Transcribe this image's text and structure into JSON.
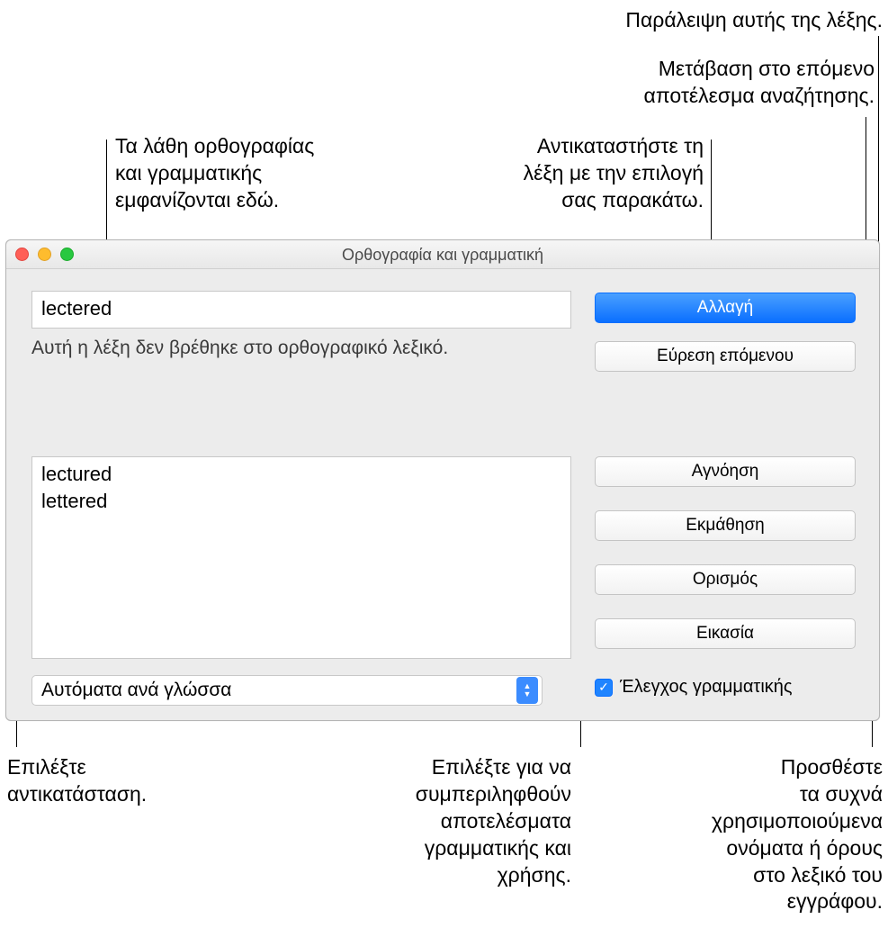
{
  "callouts": {
    "skip": "Παράλειψη αυτής της λέξης.",
    "next1": "Μετάβαση στο επόμενο",
    "next2": "αποτέλεσμα αναζήτησης.",
    "errors1": "Τα λάθη ορθογραφίας",
    "errors2": "και γραμματικής",
    "errors3": "εμφανίζονται εδώ.",
    "replace1": "Αντικαταστήστε τη",
    "replace2": "λέξη με την επιλογή",
    "replace3": "σας παρακάτω.",
    "pickrepl1": "Επιλέξτε",
    "pickrepl2": "αντικατάσταση.",
    "grammar1": "Επιλέξτε για να",
    "grammar2": "συμπεριληφθούν",
    "grammar3": "αποτελέσματα",
    "grammar4": "γραμματικής και",
    "grammar5": "χρήσης.",
    "learn1": "Προσθέστε",
    "learn2": "τα συχνά",
    "learn3": "χρησιμοποιούμενα",
    "learn4": "ονόματα ή όρους",
    "learn5": "στο λεξικό του",
    "learn6": "εγγράφου."
  },
  "window": {
    "title": "Ορθογραφία και γραμματική",
    "misspelled": "lectered",
    "status": "Αυτή η λέξη δεν βρέθηκε στο ορθογραφικό λεξικό.",
    "suggestions": [
      "lectured",
      "lettered"
    ],
    "language": "Αυτόματα ανά γλώσσα",
    "buttons": {
      "change": "Αλλαγή",
      "findnext": "Εύρεση επόμενου",
      "ignore": "Αγνόηση",
      "learn": "Εκμάθηση",
      "define": "Ορισμός",
      "guess": "Εικασία"
    },
    "grammarcheck": "Έλεγχος γραμματικής"
  }
}
